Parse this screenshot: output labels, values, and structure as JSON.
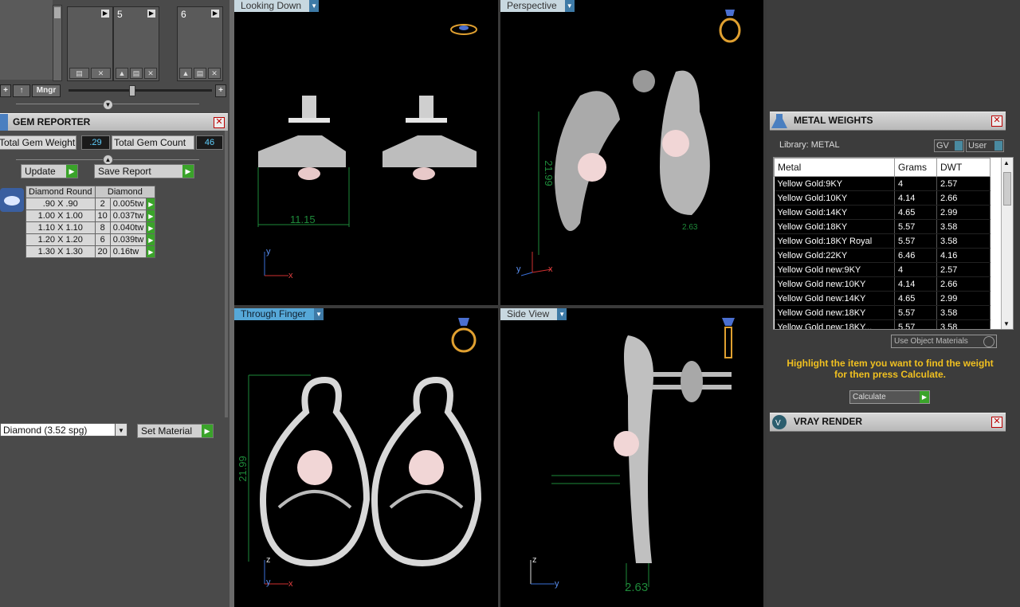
{
  "library_slots": {
    "slot5": "5",
    "slot6": "6",
    "mngr_label": "Mngr"
  },
  "gem_reporter": {
    "title": "GEM REPORTER",
    "total_weight_label": "Total Gem Weight",
    "total_weight_value": ".29",
    "total_count_label": "Total Gem Count",
    "total_count_value": "46",
    "update_label": "Update",
    "save_report_label": "Save Report",
    "table_headers": [
      "Diamond Round",
      "Diamond"
    ],
    "rows": [
      {
        "size": ".90 X .90",
        "count": "2",
        "weight": "0.005tw"
      },
      {
        "size": "1.00 X 1.00",
        "count": "10",
        "weight": "0.037tw"
      },
      {
        "size": "1.10 X 1.10",
        "count": "8",
        "weight": "0.040tw"
      },
      {
        "size": "1.20 X 1.20",
        "count": "6",
        "weight": "0.039tw"
      },
      {
        "size": "1.30 X 1.30",
        "count": "20",
        "weight": "0.16tw"
      }
    ],
    "material_select": "Diamond    (3.52 spg)",
    "set_material_label": "Set Material"
  },
  "viewports": {
    "looking_down": {
      "label": "Looking Down",
      "dim": "11.15",
      "axis1": "y",
      "axis2": "x"
    },
    "perspective": {
      "label": "Perspective",
      "dim1": "21.99",
      "dim2": "2.63",
      "axis1": "y",
      "axis2": "x"
    },
    "through_finger": {
      "label": "Through Finger",
      "dim": "21.99",
      "axis1": "z",
      "axis2": "y",
      "axis3": "x"
    },
    "side_view": {
      "label": "Side View",
      "dim": "2.63",
      "axis1": "z",
      "axis2": "y"
    }
  },
  "metal_weights": {
    "title": "METAL WEIGHTS",
    "library_label": "Library: METAL",
    "gv_label": "GV",
    "user_label": "User",
    "headers": [
      "Metal",
      "Grams",
      "DWT"
    ],
    "rows": [
      {
        "metal": "Yellow Gold:9KY",
        "grams": "4",
        "dwt": "2.57"
      },
      {
        "metal": "Yellow Gold:10KY",
        "grams": "4.14",
        "dwt": "2.66"
      },
      {
        "metal": "Yellow Gold:14KY",
        "grams": "4.65",
        "dwt": "2.99"
      },
      {
        "metal": "Yellow Gold:18KY",
        "grams": "5.57",
        "dwt": "3.58"
      },
      {
        "metal": "Yellow Gold:18KY Royal",
        "grams": "5.57",
        "dwt": "3.58"
      },
      {
        "metal": "Yellow Gold:22KY",
        "grams": "6.46",
        "dwt": "4.16"
      },
      {
        "metal": "Yellow Gold new:9KY",
        "grams": "4",
        "dwt": "2.57"
      },
      {
        "metal": "Yellow Gold new:10KY",
        "grams": "4.14",
        "dwt": "2.66"
      },
      {
        "metal": "Yellow Gold new:14KY",
        "grams": "4.65",
        "dwt": "2.99"
      },
      {
        "metal": "Yellow Gold new:18KY",
        "grams": "5.57",
        "dwt": "3.58"
      },
      {
        "metal": "Yellow Gold new:18KY...",
        "grams": "5.57",
        "dwt": "3.58"
      }
    ],
    "use_object_materials": "Use Object Materials",
    "hint": "Highlight the item you want to find the weight for then press Calculate.",
    "calculate_label": "Calculate"
  },
  "vray": {
    "title": "VRAY RENDER"
  },
  "colors": {
    "accent": "#56a8d8",
    "go_green": "#3aa32a",
    "hint_yellow": "#f0c020",
    "dim_green": "#1e8a3a"
  }
}
